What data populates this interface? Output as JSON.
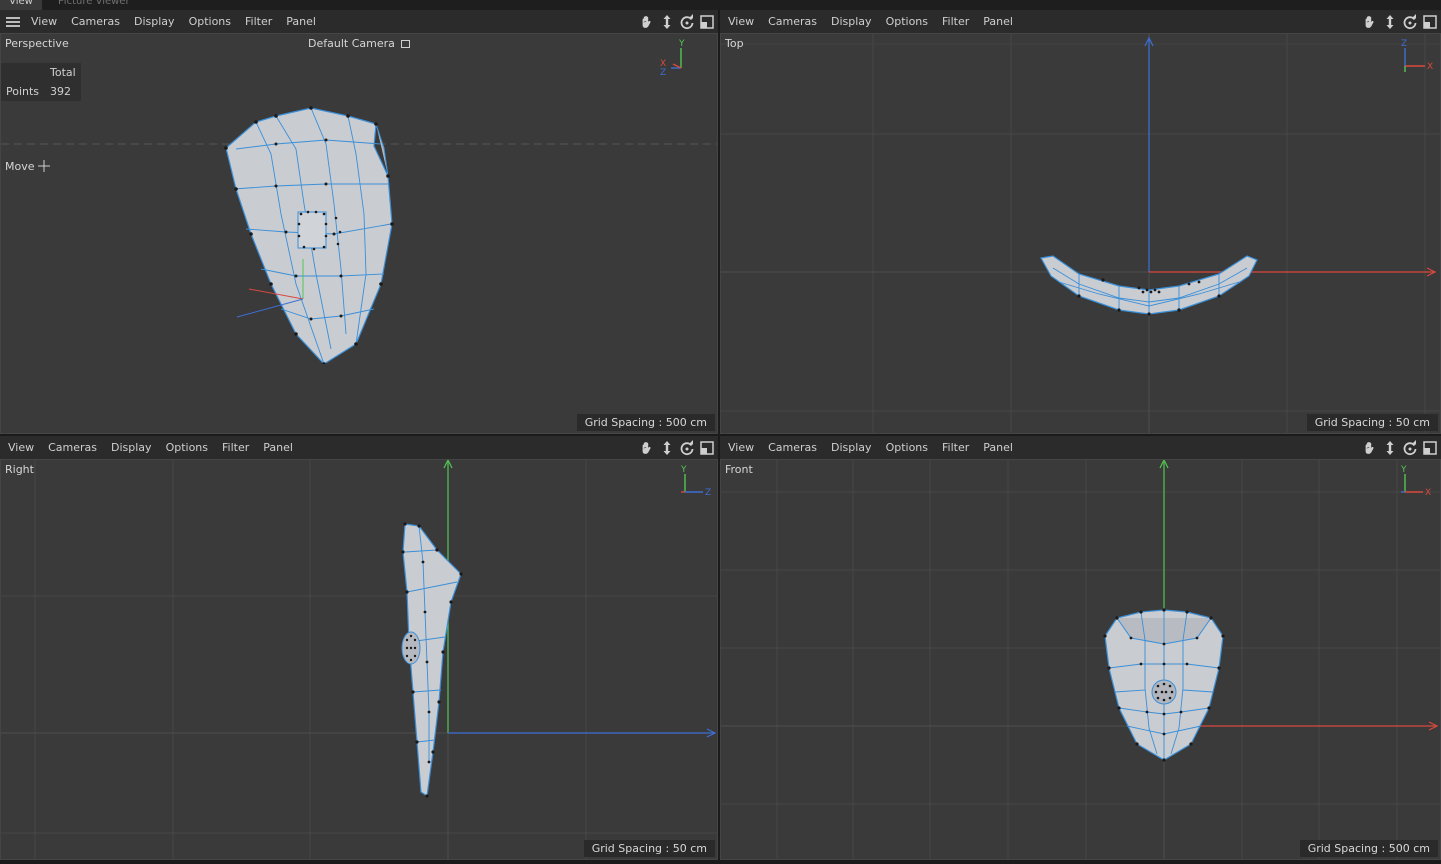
{
  "tabs": [
    "View",
    "Picture Viewer"
  ],
  "menus": [
    "View",
    "Cameras",
    "Display",
    "Options",
    "Filter",
    "Panel"
  ],
  "nav_icons": [
    "hand-pan-icon",
    "move-zoom-icon",
    "rotate-icon",
    "maximize-icon"
  ],
  "viewports": {
    "perspective": {
      "label": "Perspective",
      "camera": "Default Camera",
      "hud": {
        "column_header": "Total",
        "row_label": "Points",
        "points": "392"
      },
      "tool": "Move",
      "grid_spacing": "Grid Spacing : 500 cm"
    },
    "top": {
      "label": "Top",
      "grid_spacing": "Grid Spacing : 50 cm"
    },
    "right": {
      "label": "Right",
      "grid_spacing": "Grid Spacing : 50 cm"
    },
    "front": {
      "label": "Front",
      "grid_spacing": "Grid Spacing : 500 cm"
    }
  },
  "axis_letters": {
    "x": "X",
    "y": "Y",
    "z": "Z"
  },
  "colors": {
    "axis_x": "#d9493d",
    "axis_y": "#52c552",
    "axis_z": "#3d6fd4",
    "mesh_fill": "#c9ccd1",
    "mesh_edge": "#3a8fd9",
    "viewport_bg": "#3a3a3a"
  }
}
